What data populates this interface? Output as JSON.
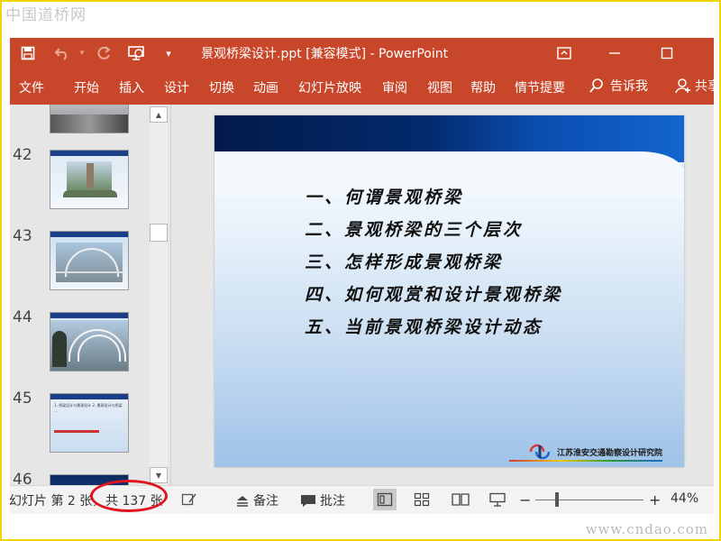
{
  "watermarks": {
    "top": "中国道桥网",
    "bottom": "www.cndao.com"
  },
  "titlebar": {
    "title": "景观桥梁设计.ppt [兼容模式] - PowerPoint",
    "icons": [
      "save-icon",
      "undo-icon",
      "redo-icon",
      "start-from-beginning-icon",
      "customize-qat-icon"
    ],
    "window_controls": [
      "ribbon-display-options-icon",
      "minimize-icon",
      "maximize-icon"
    ]
  },
  "ribbon": {
    "tabs": [
      "文件",
      "开始",
      "插入",
      "设计",
      "切换",
      "动画",
      "幻灯片放映",
      "审阅",
      "视图",
      "帮助",
      "情节提要"
    ],
    "tell_me": "告诉我",
    "share": "共享",
    "accent_color": "#c8462a"
  },
  "thumbnails": {
    "numbers": [
      "42",
      "43",
      "44",
      "45",
      "46"
    ]
  },
  "slide": {
    "lines": [
      "一、何谓景观桥梁",
      "二、景观桥梁的三个层次",
      "三、怎样形成景观桥梁",
      "四、如何观赏和设计景观桥梁",
      "五、当前景观桥梁设计动态"
    ],
    "footer_org": "江苏淮安交通勘察设计研究院"
  },
  "statusbar": {
    "slide_info": "幻灯片 第 2 张，",
    "total": "共 137 张",
    "notes": "备注",
    "comments": "批注",
    "zoom_minus": "−",
    "zoom_plus": "+",
    "zoom": "44%"
  },
  "thumb45_text": "1. 桥梁设计与景观设计 2. 景观设计与桥梁 ..."
}
